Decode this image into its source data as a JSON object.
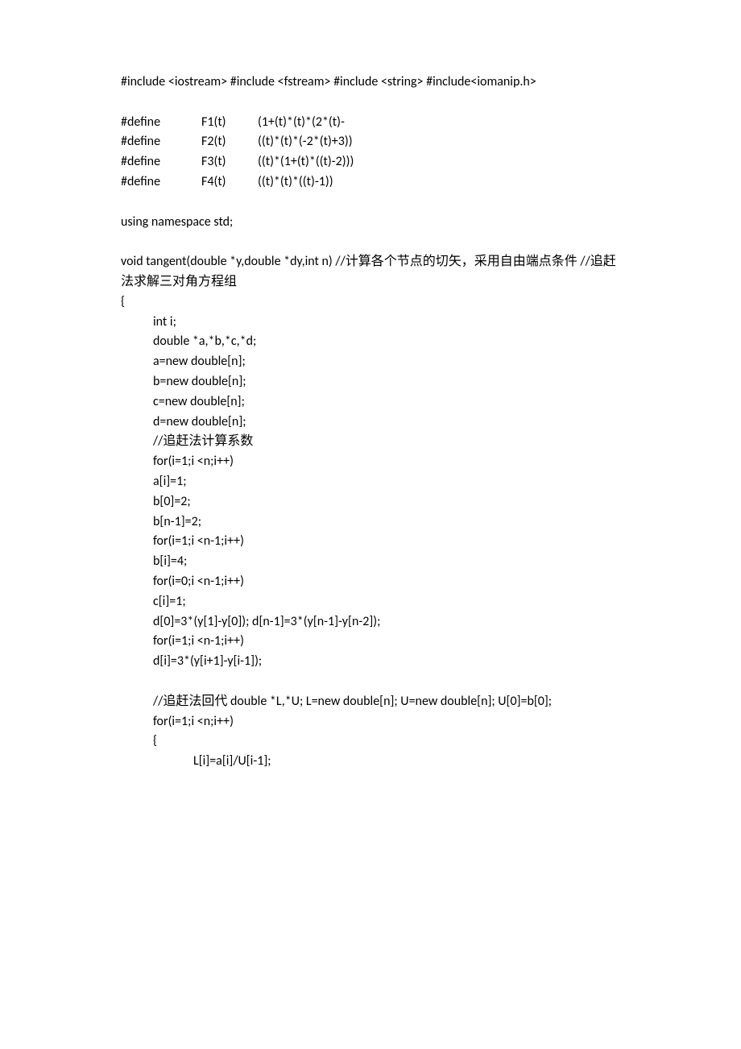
{
  "para1": "#include <iostream> #include <fstream> #include <string> #include<iomanip.h>",
  "defines": [
    {
      "kw": "#define",
      "name": "F1(t)",
      "body": "(1+(t)*(t)*(2*(t)-"
    },
    {
      "kw": "#define",
      "name": "F2(t)",
      "body": "((t)*(t)*(-2*(t)+3))"
    },
    {
      "kw": "#define",
      "name": "F3(t)",
      "body": "((t)*(1+(t)*((t)-2)))"
    },
    {
      "kw": "#define",
      "name": "F4(t)",
      "body": "((t)*(t)*((t)-1))"
    }
  ],
  "using": "using namespace std;",
  "fn_decl_pre": " void tangent(double *y,double *dy,int n) //",
  "fn_decl_cjk1": "计算各个节点的切",
  "fn_decl_cjk2": "矢，采用自由端点条件",
  "fn_decl_mid": "  //",
  "fn_decl_cjk3": "追赶法求解三对角方程组",
  "brace_open": "{",
  "body1": [
    "int i;",
    "double *a,*b,*c,*d;",
    "a=new double[n];",
    "b=new double[n];",
    "c=new double[n];",
    "d=new double[n];"
  ],
  "comment1_pre": "//",
  "comment1_cjk": "追赶法计算系数",
  "body2": [
    "for(i=1;i <n;i++)",
    "a[i]=1;",
    "b[0]=2;",
    "b[n-1]=2;",
    "for(i=1;i <n-1;i++)",
    "b[i]=4;",
    "for(i=0;i <n-1;i++)",
    "c[i]=1;",
    "d[0]=3*(y[1]-y[0]); d[n-1]=3*(y[n-1]-y[n-2]);",
    "for(i=1;i <n-1;i++)",
    "d[i]=3*(y[i+1]-y[i-1]);"
  ],
  "comment2_pre": "//",
  "comment2_cjk": "追赶法回代",
  "comment2_post": "  double *L,*U; L=new double[n]; U=new double[n]; U[0]=b[0];",
  "body3": [
    "for(i=1;i <n;i++)",
    "{"
  ],
  "body4": "L[i]=a[i]/U[i-1];"
}
